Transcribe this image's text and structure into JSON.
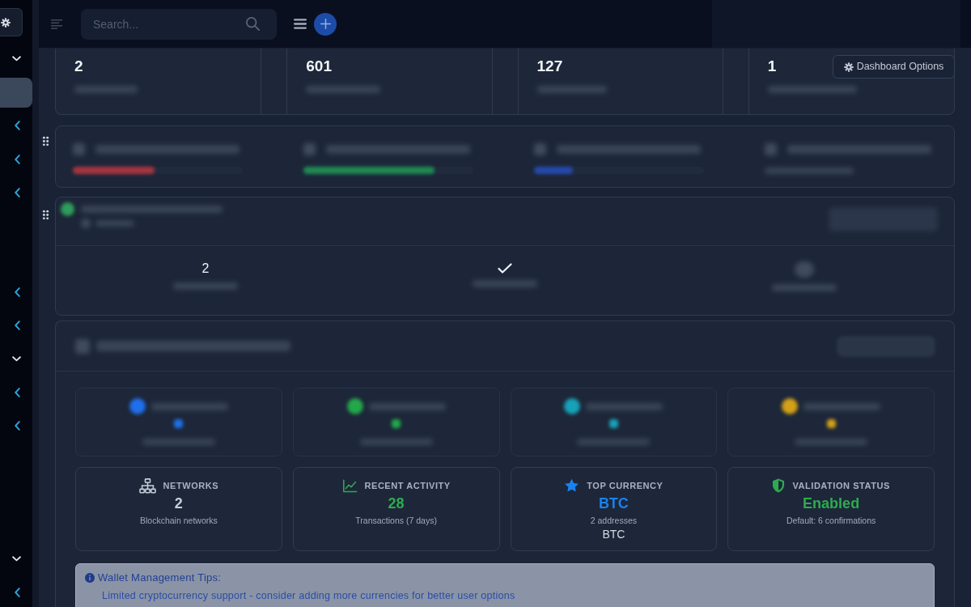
{
  "sidebar": {
    "items": [
      {
        "kind": "group",
        "expanded": true,
        "selected": false
      },
      {
        "kind": "link",
        "selected": true
      },
      {
        "kind": "group",
        "expanded": false,
        "selected": false
      },
      {
        "kind": "group",
        "expanded": false,
        "selected": false
      },
      {
        "kind": "group",
        "expanded": false,
        "selected": false
      },
      {
        "kind": "link",
        "selected": false
      },
      {
        "kind": "link",
        "selected": false
      },
      {
        "kind": "group",
        "expanded": false,
        "selected": false
      },
      {
        "kind": "group",
        "expanded": false,
        "selected": false
      },
      {
        "kind": "group",
        "expanded": true,
        "selected": false
      },
      {
        "kind": "group",
        "expanded": false,
        "selected": false
      },
      {
        "kind": "group",
        "expanded": false,
        "selected": false
      },
      {
        "kind": "link",
        "selected": false
      },
      {
        "kind": "link",
        "selected": false
      },
      {
        "kind": "link",
        "selected": false
      },
      {
        "kind": "group",
        "expanded": true,
        "selected": false
      },
      {
        "kind": "group",
        "expanded": false,
        "selected": false
      }
    ]
  },
  "topbar": {
    "search": {
      "placeholder": "Search..."
    }
  },
  "dashboard_options": {
    "label": "Dashboard Options"
  },
  "stats": [
    {
      "value": "2"
    },
    {
      "value": "601"
    },
    {
      "value": "127"
    },
    {
      "value": "1"
    }
  ],
  "metrics": [
    {
      "kind": "bar",
      "level": 0.48,
      "color": "#a8343f"
    },
    {
      "kind": "bar",
      "level": 0.77,
      "color": "#1f8a52"
    },
    {
      "kind": "bar",
      "level": 0.23,
      "color": "#2449ad"
    },
    {
      "kind": "text"
    }
  ],
  "overview_summary": {
    "items": [
      {
        "kind": "text",
        "value": "2"
      },
      {
        "kind": "check"
      },
      {
        "kind": "icon"
      }
    ]
  },
  "wallet_overview": {
    "tiles": [
      {
        "color": "#1f6feb"
      },
      {
        "color": "#22a84a"
      },
      {
        "color": "#17a2b8"
      },
      {
        "color": "#d4a017"
      }
    ],
    "stats": [
      {
        "kind": "network",
        "label": "NETWORKS",
        "value": "2",
        "color": "#c7ced9",
        "note": "Blockchain networks"
      },
      {
        "kind": "chart",
        "label": "RECENT ACTIVITY",
        "value": "28",
        "color": "#2eab4f",
        "note": "Transactions (7 days)"
      },
      {
        "kind": "star",
        "label": "TOP CURRENCY",
        "value": "BTC",
        "color": "#1a82f0",
        "note": "2 addresses",
        "extra": "BTC"
      },
      {
        "kind": "shield",
        "label": "VALIDATION STATUS",
        "value": "Enabled",
        "color": "#2eab4f",
        "note": "Default: 6 confirmations"
      }
    ]
  },
  "tips": {
    "title": "Wallet Management Tips:",
    "text": "Limited cryptocurrency support - consider adding more currencies for better user options"
  }
}
